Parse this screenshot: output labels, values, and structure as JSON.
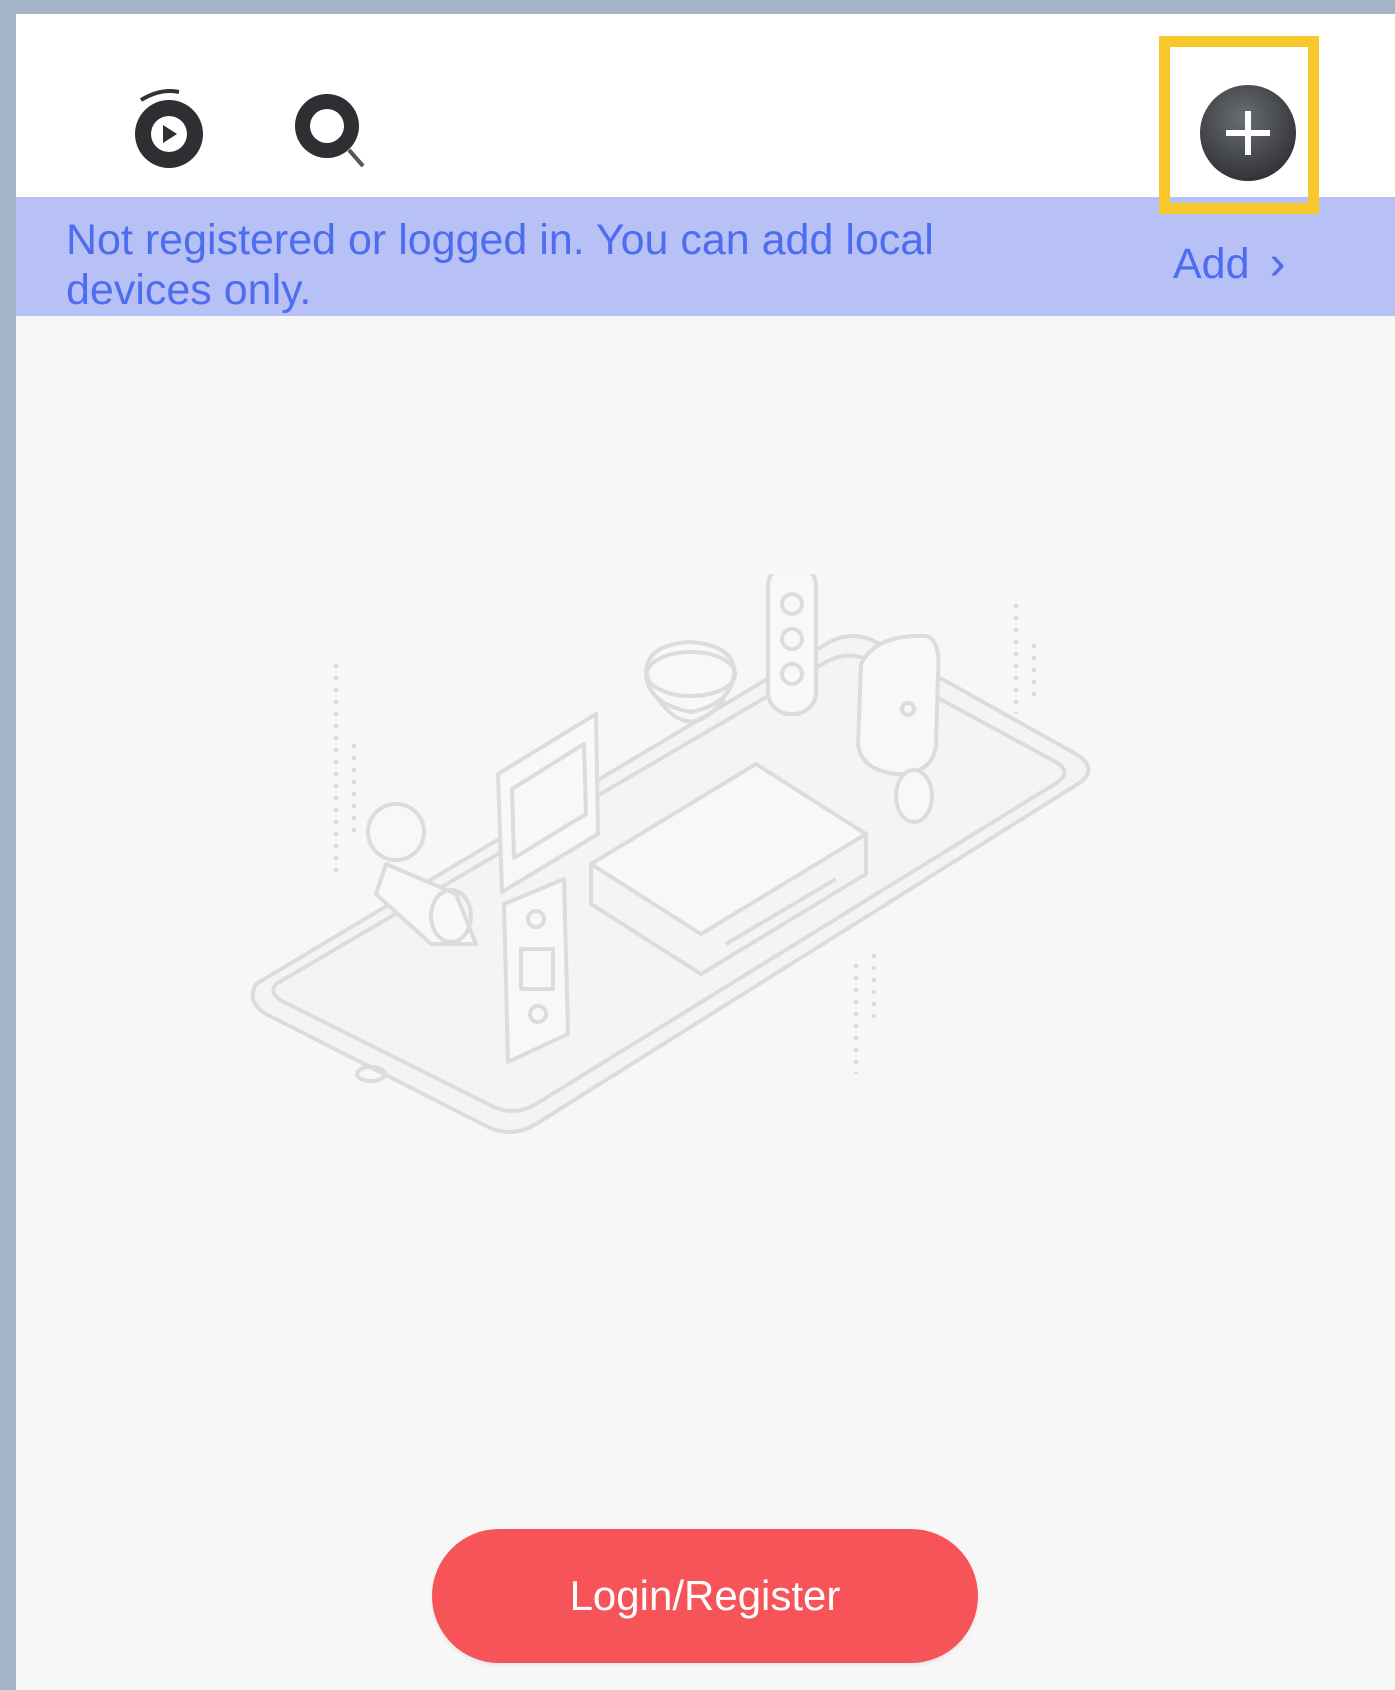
{
  "topbar": {
    "icons": [
      "playback-icon",
      "search-device-icon",
      "add-device-icon"
    ]
  },
  "banner": {
    "message": "Not registered or logged in. You can add local devices only.",
    "add_label": "Add",
    "chevron": "›"
  },
  "login": {
    "label": "Login/Register"
  },
  "colors": {
    "banner_bg": "#b8c1f6",
    "banner_text": "#4e6cf0",
    "highlight": "#f6c82b",
    "login_bg": "#f65458"
  }
}
